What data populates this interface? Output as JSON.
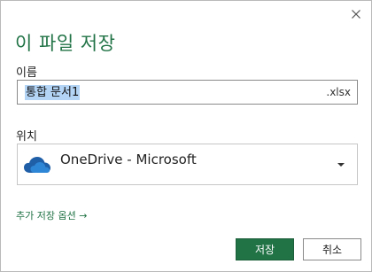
{
  "dialog": {
    "title": "이 파일 저장",
    "close_icon": "close-icon"
  },
  "name_section": {
    "label": "이름",
    "value": "통합 문서1",
    "extension": ".xlsx"
  },
  "location_section": {
    "label": "위치",
    "selected": "OneDrive - Microsoft",
    "icon": "onedrive-cloud-icon"
  },
  "more_options": {
    "label": "추가 저장 옵션 →"
  },
  "buttons": {
    "save": "저장",
    "cancel": "취소"
  },
  "colors": {
    "accent": "#217346",
    "selection": "#b3d4f5",
    "onedrive_blue": "#1f5fa8"
  }
}
